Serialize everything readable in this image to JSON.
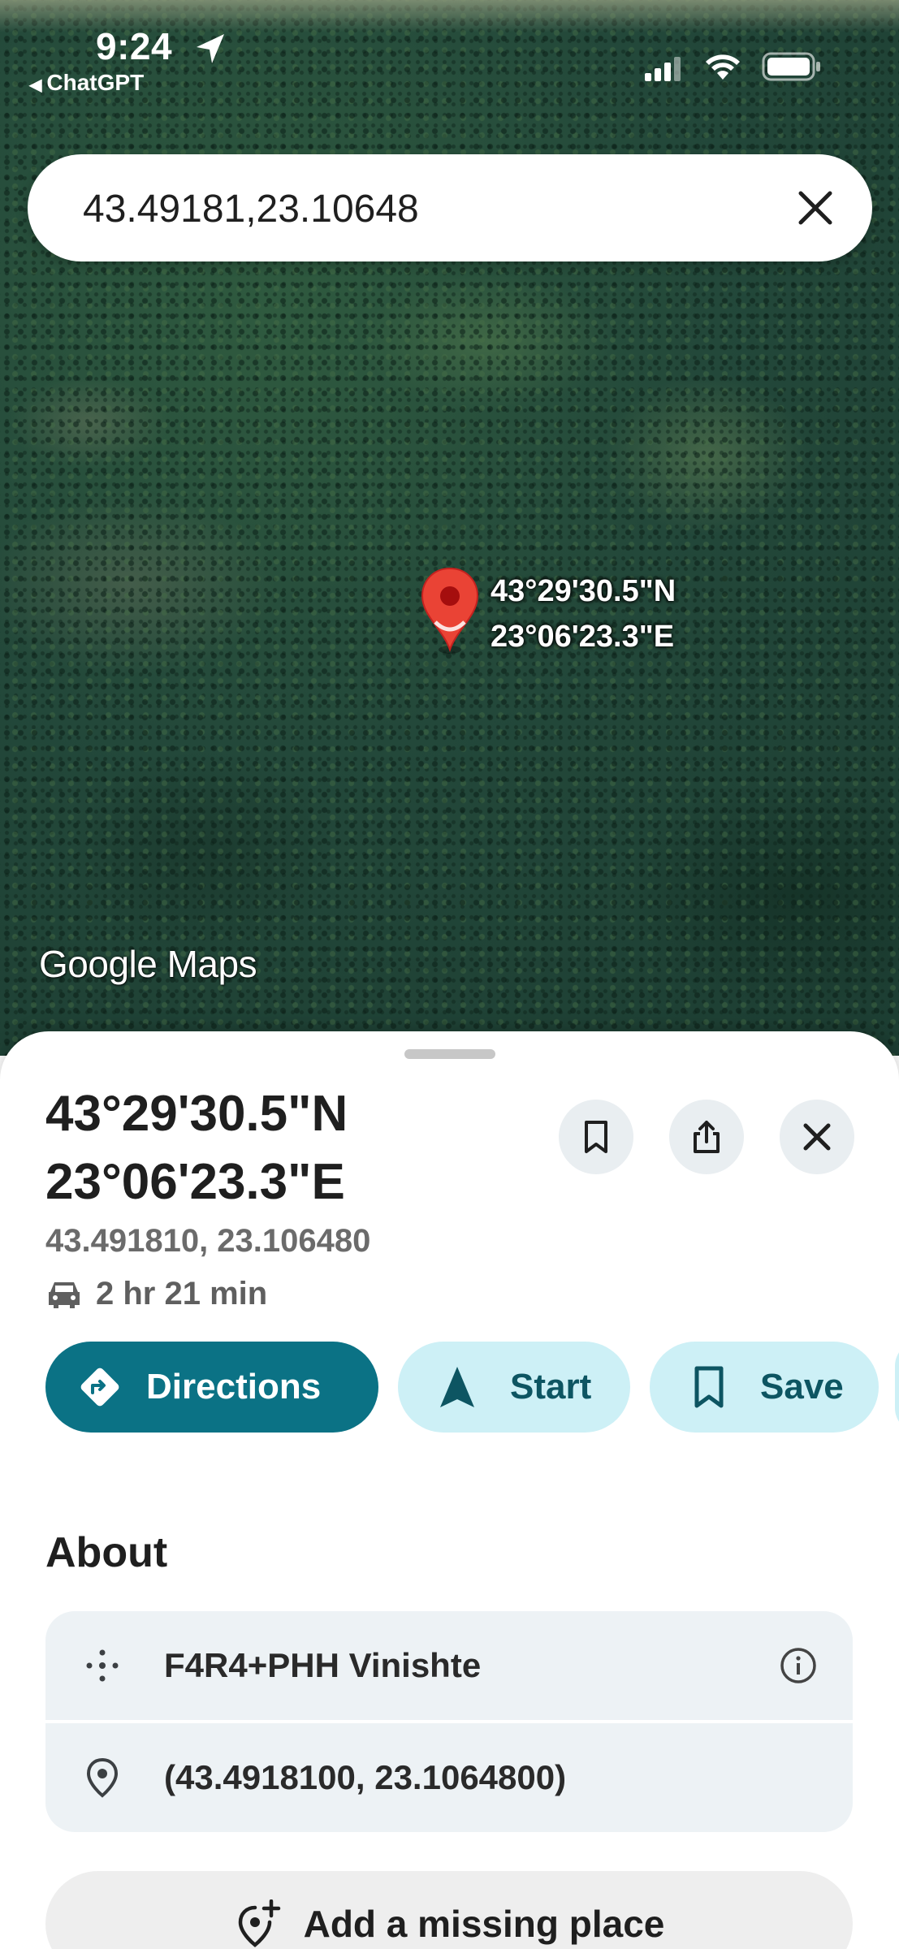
{
  "status_bar": {
    "time": "9:24",
    "back_app": "ChatGPT"
  },
  "search": {
    "query": "43.49181,23.10648"
  },
  "map": {
    "pin_label_lat": "43°29'30.5\"N",
    "pin_label_lng": "23°06'23.3\"E",
    "logo": "Google Maps"
  },
  "sheet": {
    "title_line1": "43°29'30.5\"N",
    "title_line2": "23°06'23.3\"E",
    "coords": "43.491810, 23.106480",
    "drive_time": "2 hr 21 min",
    "actions": {
      "directions": "Directions",
      "start": "Start",
      "save": "Save"
    },
    "about_heading": "About",
    "plus_code": "F4R4+PHH Vinishte",
    "lat_lng": "(43.4918100, 23.1064800)",
    "add_missing_place": "Add a missing place"
  },
  "colors": {
    "accent": "#0b7285",
    "chip_tonal": "#cdf0f6",
    "pin_red": "#ea4335"
  },
  "icons": [
    "location-arrow-icon",
    "signal-icon",
    "wifi-icon",
    "battery-icon",
    "close-icon",
    "map-pin-icon",
    "bookmark-icon",
    "share-icon",
    "car-icon",
    "directions-icon",
    "navigation-arrow-icon",
    "plus-code-icon",
    "info-icon",
    "location-pin-icon",
    "add-place-icon"
  ]
}
